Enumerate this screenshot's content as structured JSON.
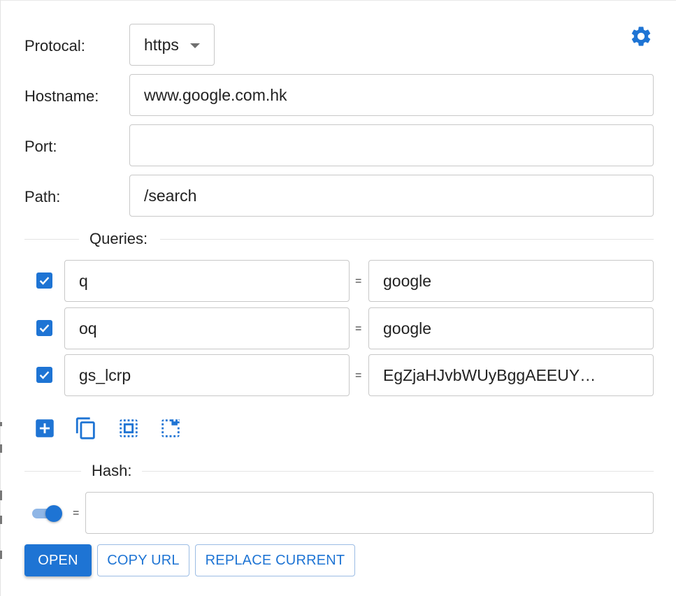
{
  "form": {
    "protocol": {
      "label": "Protocal:",
      "value": "https"
    },
    "hostname": {
      "label": "Hostname:",
      "value": "www.google.com.hk"
    },
    "port": {
      "label": "Port:",
      "value": ""
    },
    "path": {
      "label": "Path:",
      "value": "/search"
    }
  },
  "settings": {
    "icon": "gear-icon"
  },
  "queries": {
    "title": "Queries:",
    "separator": "=",
    "rows": [
      {
        "enabled": true,
        "key": "q",
        "value": "google"
      },
      {
        "enabled": true,
        "key": "oq",
        "value": "google"
      },
      {
        "enabled": true,
        "key": "gs_lcrp",
        "value": "EgZjaHJvbWUyBggAEEUY…"
      }
    ],
    "toolbar": [
      "add-box-icon",
      "copy-icon",
      "select-all-icon",
      "select-window-icon"
    ]
  },
  "hash": {
    "title": "Hash:",
    "enabled": true,
    "separator": "=",
    "value": ""
  },
  "actions": {
    "open": "OPEN",
    "copy_url": "COPY URL",
    "replace_current": "REPLACE CURRENT"
  },
  "colors": {
    "accent": "#1e74d4",
    "toggle_track": "#8fb6e6",
    "border": "#c8c8c8"
  }
}
